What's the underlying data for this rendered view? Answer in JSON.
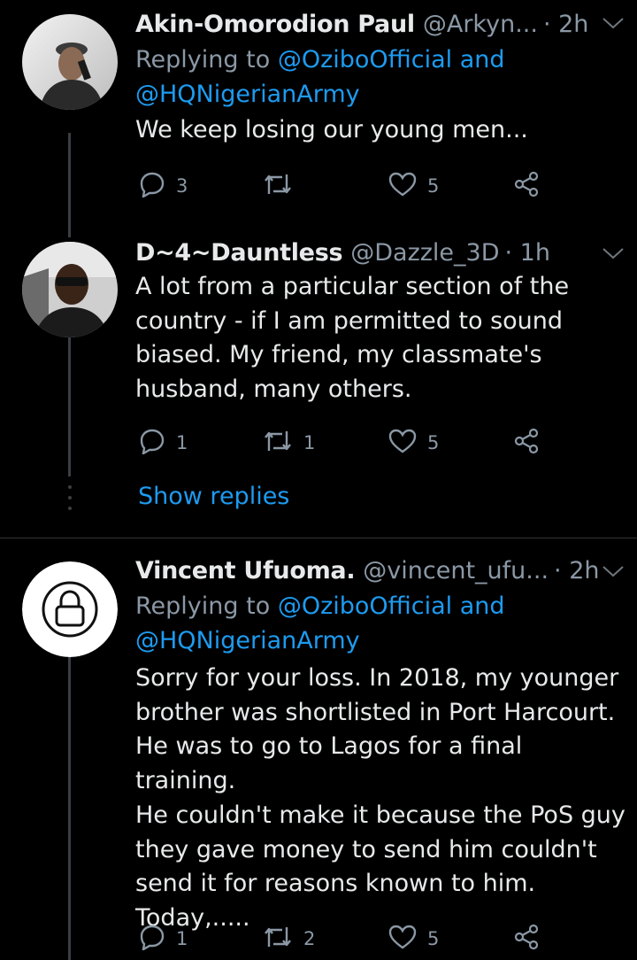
{
  "tweets": [
    {
      "name": "Akin-Omorodion Paul",
      "handle": "@Arkyn...",
      "time": "· 2h",
      "replying_prefix": "Replying to ",
      "replying_to_1": "@OziboOfficial and",
      "replying_to_2": "@HQNigerianArmy",
      "text": "We keep losing our young men...",
      "replies": "3",
      "retweets": "",
      "likes": "5"
    },
    {
      "name": "D~4~Dauntless",
      "handle": "@Dazzle_3D",
      "time": "· 1h",
      "text_lines": [
        "A lot from a particular section of the",
        "country - if I am permitted to sound",
        "biased. My friend, my classmate's",
        "husband, many others."
      ],
      "replies": "1",
      "retweets": "1",
      "likes": "5"
    },
    {
      "name": "Vincent Ufuoma.",
      "handle": "@vincent_ufu...",
      "time": "· 2h",
      "replying_prefix": "Replying to ",
      "replying_to_1": "@OziboOfficial and",
      "replying_to_2": "@HQNigerianArmy",
      "text_lines": [
        "Sorry for your loss. In 2018, my younger",
        "brother was shortlisted in Port Harcourt.",
        "He was to go to Lagos for a final training.",
        "He couldn't make it because the PoS guy",
        "they gave money to send him couldn't",
        "send it for reasons known to him.",
        "Today,....."
      ],
      "replies": "1",
      "retweets": "2",
      "likes": "5"
    }
  ],
  "show_replies": "Show replies",
  "icons": [
    "reply-icon",
    "retweet-icon",
    "like-icon",
    "share-icon",
    "chevron-down-icon",
    "lock-icon"
  ],
  "colors": {
    "background": "#000000",
    "link": "#1d9bf0",
    "muted": "#8b98a5",
    "text": "#e7e9ea"
  }
}
